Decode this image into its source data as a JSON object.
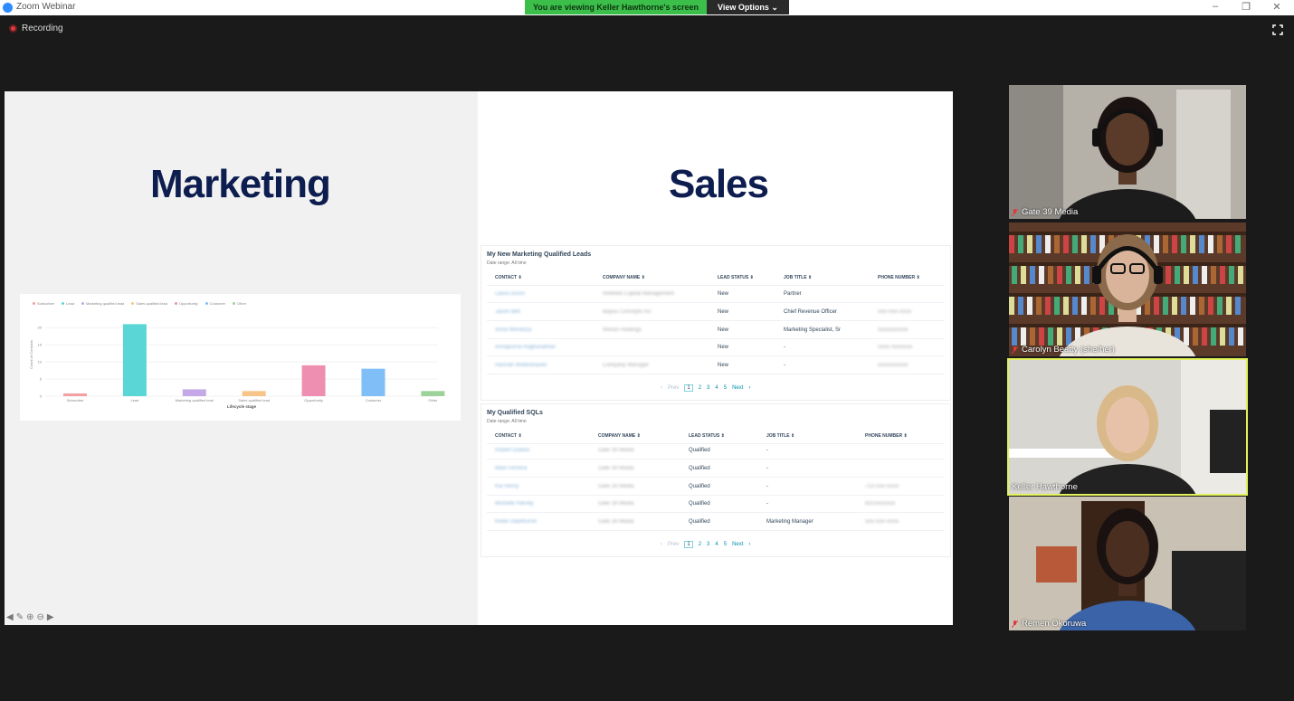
{
  "window": {
    "title": "Zoom Webinar",
    "banner": "You are viewing Keller Hawthorne's screen",
    "view_options": "View Options",
    "recording": "Recording"
  },
  "colors": {
    "banner": "#3cbf4a",
    "title_navy": "#0d1d4f",
    "active_speaker": "#e2f25a"
  },
  "slide": {
    "left_title": "Marketing",
    "right_title": "Sales"
  },
  "chart_data": {
    "type": "bar",
    "categories": [
      "Subscriber",
      "Lead",
      "Marketing qualified lead",
      "Sales qualified lead",
      "Opportunity",
      "Customer",
      "Other"
    ],
    "values": [
      0.8,
      21,
      2,
      1.5,
      9,
      8,
      1.5
    ],
    "colors": [
      "#f2a0a0",
      "#5bd6d6",
      "#c4a8e8",
      "#f7c48a",
      "#ee8fb2",
      "#7fbef7",
      "#9dd39a"
    ],
    "legend": [
      "Subscriber",
      "Lead",
      "Marketing qualified lead",
      "Sales qualified lead",
      "Opportunity",
      "Customer",
      "Other"
    ],
    "xlabel": "Lifecycle stage",
    "ylabel": "Count of Contacts",
    "yticks": [
      "0",
      "5",
      "10",
      "15",
      "20"
    ],
    "ylim": [
      0,
      24
    ],
    "grid": true,
    "legend_position": "top-left"
  },
  "mql_table": {
    "title": "My New Marketing Qualified Leads",
    "subtitle": "Date range: All time",
    "headers": [
      "CONTACT",
      "COMPANY NAME",
      "LEAD STATUS",
      "JOB TITLE",
      "PHONE NUMBER"
    ],
    "rows": [
      {
        "contact": "Laura Gross",
        "company": "Redfield Capital Management",
        "status": "New",
        "job": "Partner",
        "phone": ""
      },
      {
        "contact": "Jason Bell",
        "company": "Bayou Concepts Inc",
        "status": "New",
        "job": "Chief Revenue Officer",
        "phone": "555-555-5555"
      },
      {
        "contact": "Anna Mendoza",
        "company": "Wilson Holdings",
        "status": "New",
        "job": "Marketing Specialist, Sr",
        "phone": "5555555555"
      },
      {
        "contact": "Annapurna Raghunathan",
        "company": "",
        "status": "New",
        "job": "-",
        "phone": "5555 5555555"
      },
      {
        "contact": "Hannah Wildenhaven",
        "company": "Company Manager",
        "status": "New",
        "job": "-",
        "phone": "5555555555"
      }
    ],
    "pager": {
      "prev": "Prev",
      "pages": [
        "1",
        "2",
        "3",
        "4",
        "5"
      ],
      "next": "Next"
    }
  },
  "sql_table": {
    "title": "My Qualified SQLs",
    "subtitle": "Date range: All time",
    "headers": [
      "CONTACT",
      "COMPANY NAME",
      "LEAD STATUS",
      "JOB TITLE",
      "PHONE NUMBER"
    ],
    "rows": [
      {
        "contact": "Robert Dubois",
        "company": "Gate 39 Media",
        "status": "Qualified",
        "job": "-",
        "phone": ""
      },
      {
        "contact": "Mike Ferreira",
        "company": "Gate 39 Media",
        "status": "Qualified",
        "job": "-",
        "phone": ""
      },
      {
        "contact": "Kai Henry",
        "company": "Gate 39 Media",
        "status": "Qualified",
        "job": "-",
        "phone": "713-555-5555"
      },
      {
        "contact": "Michelle Harvey",
        "company": "Gate 39 Media",
        "status": "Qualified",
        "job": "-",
        "phone": "8315555555"
      },
      {
        "contact": "Keller Hawthorne",
        "company": "Gate 39 Media",
        "status": "Qualified",
        "job": "Marketing Manager",
        "phone": "555-555-5555"
      }
    ],
    "pager": {
      "prev": "Prev",
      "pages": [
        "1",
        "2",
        "3",
        "4",
        "5"
      ],
      "next": "Next"
    }
  },
  "participants": [
    {
      "name": "Gate 39 Media",
      "bg": "#b5b0a8",
      "skin": "#5a3a28",
      "hair": "#1a1210",
      "shirt": "#1c1c1c",
      "active": false
    },
    {
      "name": "Carolyn Beatty (she/her)",
      "bg": "#5b3a2a",
      "skin": "#d9b49a",
      "hair": "#8a6a4a",
      "shirt": "#e8e4dc",
      "active": false
    },
    {
      "name": "Keller Hawthorne",
      "bg": "#d8d6d0",
      "skin": "#e8c2a8",
      "hair": "#d9b98a",
      "shirt": "#222222",
      "active": true
    },
    {
      "name": "Remen Okoruwa",
      "bg": "#c9c2b4",
      "skin": "#4a2e20",
      "hair": "#1a1210",
      "shirt": "#3b64a8",
      "active": false
    }
  ]
}
